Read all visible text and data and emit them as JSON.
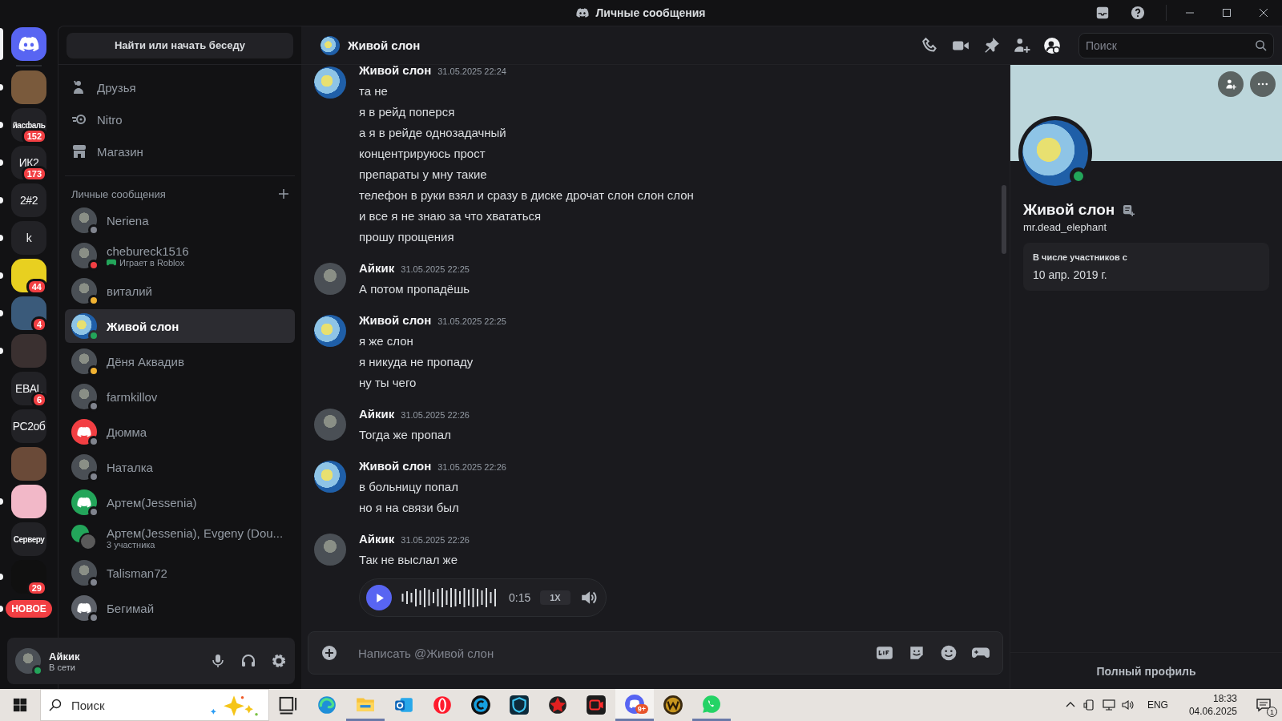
{
  "titlebar": {
    "title": "Личные сообщения"
  },
  "servers": [
    {
      "kind": "home",
      "selected": true
    },
    {
      "kind": "image",
      "selected": false,
      "unread": true
    },
    {
      "kind": "text",
      "label": "йасфаль",
      "small": true,
      "badge": "152",
      "selected": false,
      "unread": true
    },
    {
      "kind": "text",
      "label": "ИК2",
      "small": false,
      "badge": "173",
      "selected": false,
      "unread": true
    },
    {
      "kind": "text",
      "label": "2#2",
      "small": false,
      "selected": false,
      "unread": true
    },
    {
      "kind": "text",
      "label": "k",
      "small": false,
      "selected": false,
      "unread": true
    },
    {
      "kind": "image",
      "badge": "44",
      "selected": false,
      "unread": true
    },
    {
      "kind": "image",
      "badge": "4",
      "selected": false,
      "unread": true
    },
    {
      "kind": "image",
      "selected": false,
      "unread": true
    },
    {
      "kind": "text",
      "label": "EBAL",
      "small": false,
      "badge": "6",
      "selected": false,
      "unread": false
    },
    {
      "kind": "text",
      "label": "PC2об",
      "small": false,
      "selected": false,
      "unread": false
    },
    {
      "kind": "image",
      "selected": false,
      "unread": false
    },
    {
      "kind": "image",
      "selected": false,
      "unread": true
    },
    {
      "kind": "text",
      "label": "Серверу",
      "small": true,
      "selected": false,
      "unread": false
    },
    {
      "kind": "image",
      "badge": "29",
      "selected": false,
      "unread": true
    },
    {
      "kind": "new",
      "label": "НОВОЕ",
      "selected": false,
      "unread": true
    }
  ],
  "sidebar": {
    "search_button": "Найти или начать беседу",
    "nav": [
      {
        "kind": "friends",
        "label": "Друзья"
      },
      {
        "kind": "nitro",
        "label": "Nitro"
      },
      {
        "kind": "shop",
        "label": "Магазин"
      }
    ],
    "dm_header": "Личные сообщения",
    "dms": [
      {
        "name": "Neriena",
        "avatar": {
          "kind": "photo"
        },
        "color": "#80848e",
        "selected": false
      },
      {
        "name": "chebureck1516",
        "activity": "Играет в Roblox",
        "avatar": {
          "kind": "photo"
        },
        "color": "#f23f43",
        "selected": false
      },
      {
        "name": "виталий",
        "avatar": {
          "kind": "photo"
        },
        "color": "#f0b232",
        "selected": false
      },
      {
        "name": "Живой слон",
        "avatar": {
          "kind": "elephant"
        },
        "color": "#23a55a",
        "selected": true
      },
      {
        "name": "Дёня Аквадив",
        "avatar": {
          "kind": "photo"
        },
        "color": "#f0b232",
        "selected": false
      },
      {
        "name": "farmkillov",
        "avatar": {
          "kind": "photo"
        },
        "color": "#80848e",
        "selected": false
      },
      {
        "name": "Дюмма",
        "avatar": {
          "kind": "discord",
          "color": "#f23f43"
        },
        "color": "#80848e",
        "selected": false
      },
      {
        "name": "Наталка",
        "avatar": {
          "kind": "photo"
        },
        "color": "#80848e",
        "selected": false
      },
      {
        "name": "Артем(Jessenia)",
        "avatar": {
          "kind": "discord",
          "color": "#23a55a"
        },
        "color": "#80848e",
        "selected": false
      },
      {
        "name": "Артем(Jessenia), Evgeny (Dou...",
        "members": "3 участника",
        "avatar": {
          "kind": "group"
        },
        "selected": false
      },
      {
        "name": "Talisman72",
        "avatar": {
          "kind": "photo"
        },
        "color": "#80848e",
        "selected": false
      },
      {
        "name": "Бегимай",
        "avatar": {
          "kind": "discord",
          "color": "#5d6169"
        },
        "color": "#80848e",
        "selected": false
      }
    ]
  },
  "user_panel": {
    "name": "Айкик",
    "status": "В сети"
  },
  "chat": {
    "title": "Живой слон",
    "search": {
      "placeholder": "Поиск"
    },
    "messages": [
      {
        "author": "Живой слон",
        "avatar": {
          "kind": "elephant"
        },
        "time": "31.05.2025 22:24",
        "lines": [
          "та не",
          "я в рейд поперся",
          "а я в рейде однозадачный",
          "концентрируюсь прост",
          "препараты у мну такие",
          "телефон в руки взял и сразу в диске дрочат слон слон слон",
          "и все я не знаю за что хвататься",
          "прошу прощения"
        ]
      },
      {
        "author": "Айкик",
        "avatar": {
          "kind": "photo"
        },
        "time": "31.05.2025 22:25",
        "lines": [
          "А потом пропадёшь"
        ]
      },
      {
        "author": "Живой слон",
        "avatar": {
          "kind": "elephant"
        },
        "time": "31.05.2025 22:25",
        "lines": [
          "я же слон",
          "я никуда не пропаду",
          "ну ты чего"
        ]
      },
      {
        "author": "Айкик",
        "avatar": {
          "kind": "photo"
        },
        "time": "31.05.2025 22:26",
        "lines": [
          "Тогда же пропал"
        ]
      },
      {
        "author": "Живой слон",
        "avatar": {
          "kind": "elephant"
        },
        "time": "31.05.2025 22:26",
        "lines": [
          "в больницу попал",
          "но я на связи был"
        ]
      },
      {
        "author": "Айкик",
        "avatar": {
          "kind": "photo"
        },
        "time": "31.05.2025 22:26",
        "lines": [
          "Так не выслал же"
        ],
        "voice": {
          "duration": "0:15",
          "speed": "1X"
        }
      }
    ],
    "composer": {
      "placeholder": "Написать @Живой слон"
    }
  },
  "profile": {
    "name": "Живой слон",
    "username": "mr.dead_elephant",
    "member_since_label": "В числе участников с",
    "member_since": "10 апр. 2019 г.",
    "full_profile": "Полный профиль"
  },
  "taskbar": {
    "search": {
      "placeholder": "Поиск"
    },
    "discord_badge": "9+",
    "language": "ENG",
    "time": "18:33",
    "date": "04.06.2025",
    "notifications": "1"
  }
}
